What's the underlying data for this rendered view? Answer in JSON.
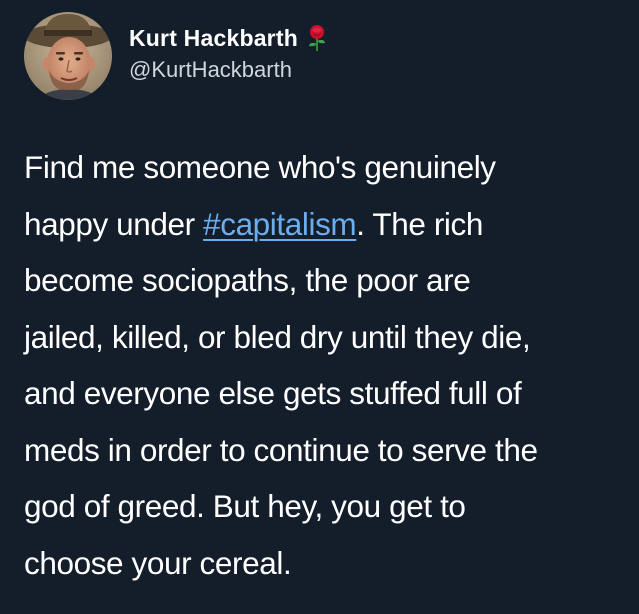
{
  "tweet": {
    "author": {
      "display_name": "Kurt Hackbarth",
      "handle": "@KurtHackbarth",
      "name_emoji_icon": "rose-icon",
      "avatar_icon": "avatar-photo"
    },
    "body_lines": [
      {
        "before": "Find me someone who's genuinely",
        "hashtag": "",
        "after": ""
      },
      {
        "before": "happy under ",
        "hashtag": "#capitalism",
        "after": ". The rich"
      },
      {
        "before": "become sociopaths, the poor are",
        "hashtag": "",
        "after": ""
      },
      {
        "before": "jailed, killed, or bled dry until they die,",
        "hashtag": "",
        "after": ""
      },
      {
        "before": "and everyone else gets stuffed full of",
        "hashtag": "",
        "after": ""
      },
      {
        "before": "meds in order to continue to serve the",
        "hashtag": "",
        "after": ""
      },
      {
        "before": "god of greed. But hey, you get to",
        "hashtag": "",
        "after": ""
      },
      {
        "before": "choose your cereal.",
        "hashtag": "",
        "after": ""
      }
    ]
  },
  "colors": {
    "background": "#141d2a",
    "text": "#ffffff",
    "handle": "#cfd6dc",
    "hashtag": "#6aaef0"
  }
}
